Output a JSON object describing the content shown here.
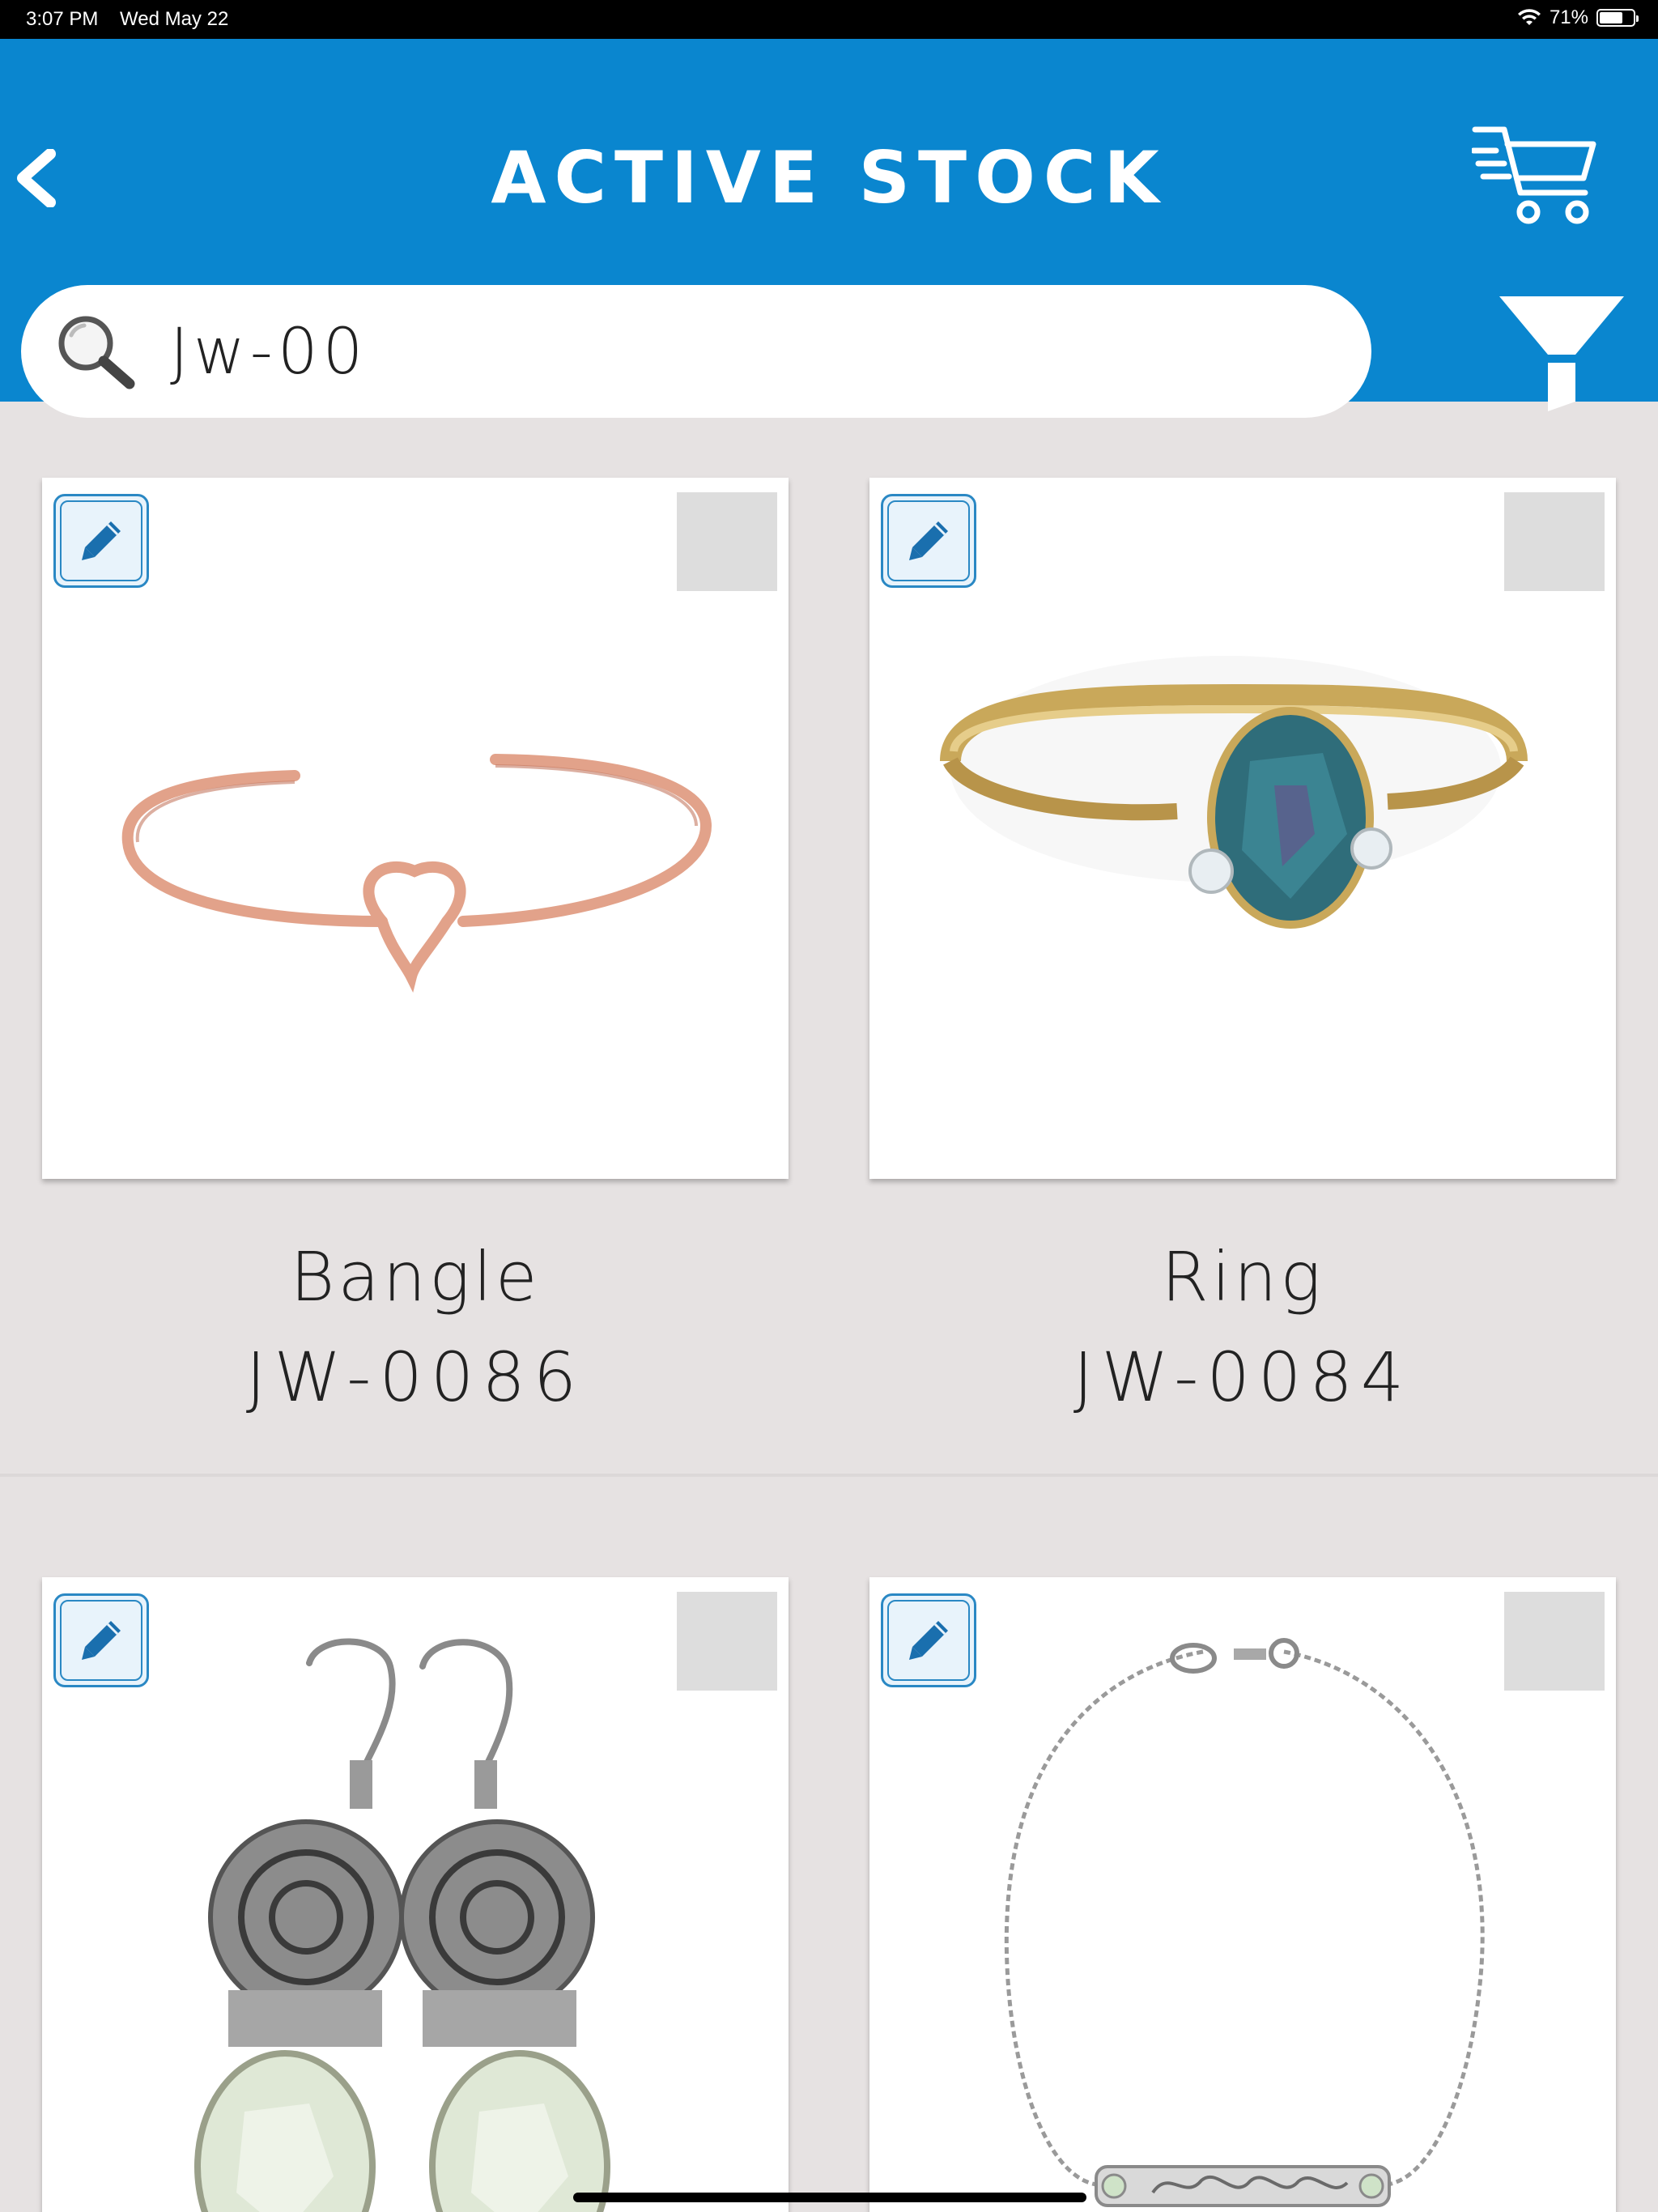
{
  "status_bar": {
    "time": "3:07 PM",
    "date": "Wed May 22",
    "battery": "71%",
    "battery_level": 0.71
  },
  "header": {
    "title": "ACTIVE STOCK",
    "back_icon": "chevron-left-icon",
    "cart_icon": "cart-icon",
    "filter_icon": "funnel-icon"
  },
  "search": {
    "value": "Jw-00",
    "icon": "search-icon"
  },
  "colors": {
    "header_bg": "#0a86cf",
    "page_bg": "#e6e2e2",
    "edit_accent": "#2a88c4"
  },
  "products": [
    {
      "name": "Bangle",
      "code": "JW-0086",
      "image": "rose-gold heart knot bangle"
    },
    {
      "name": "Ring",
      "code": "JW-0084",
      "image": "gold ring with oval alexandrite stone"
    },
    {
      "name": "",
      "code": "",
      "image": "silver earrings with green amethyst"
    },
    {
      "name": "",
      "code": "",
      "image": "silver chain bracelet with name bar"
    }
  ]
}
